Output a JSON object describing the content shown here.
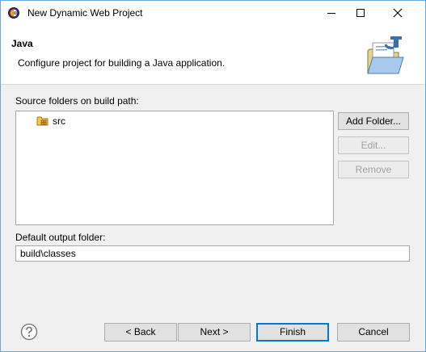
{
  "window": {
    "title": "New Dynamic Web Project",
    "controls": {
      "minimize": "minimize",
      "maximize": "maximize",
      "close": "close"
    }
  },
  "header": {
    "title": "Java",
    "description": "Configure project for building a Java application."
  },
  "source_folders": {
    "label": "Source folders on build path:",
    "items": [
      {
        "label": "src",
        "icon": "package-folder-icon"
      }
    ],
    "buttons": {
      "add": "Add Folder...",
      "edit": "Edit...",
      "remove": "Remove"
    }
  },
  "output": {
    "label": "Default output folder:",
    "value": "build\\classes"
  },
  "footer": {
    "back": "< Back",
    "next": "Next >",
    "finish": "Finish",
    "cancel": "Cancel"
  },
  "colors": {
    "window_border": "#6aa7d9",
    "default_button_border": "#0078d7",
    "disabled_text": "#a0a0a0"
  }
}
